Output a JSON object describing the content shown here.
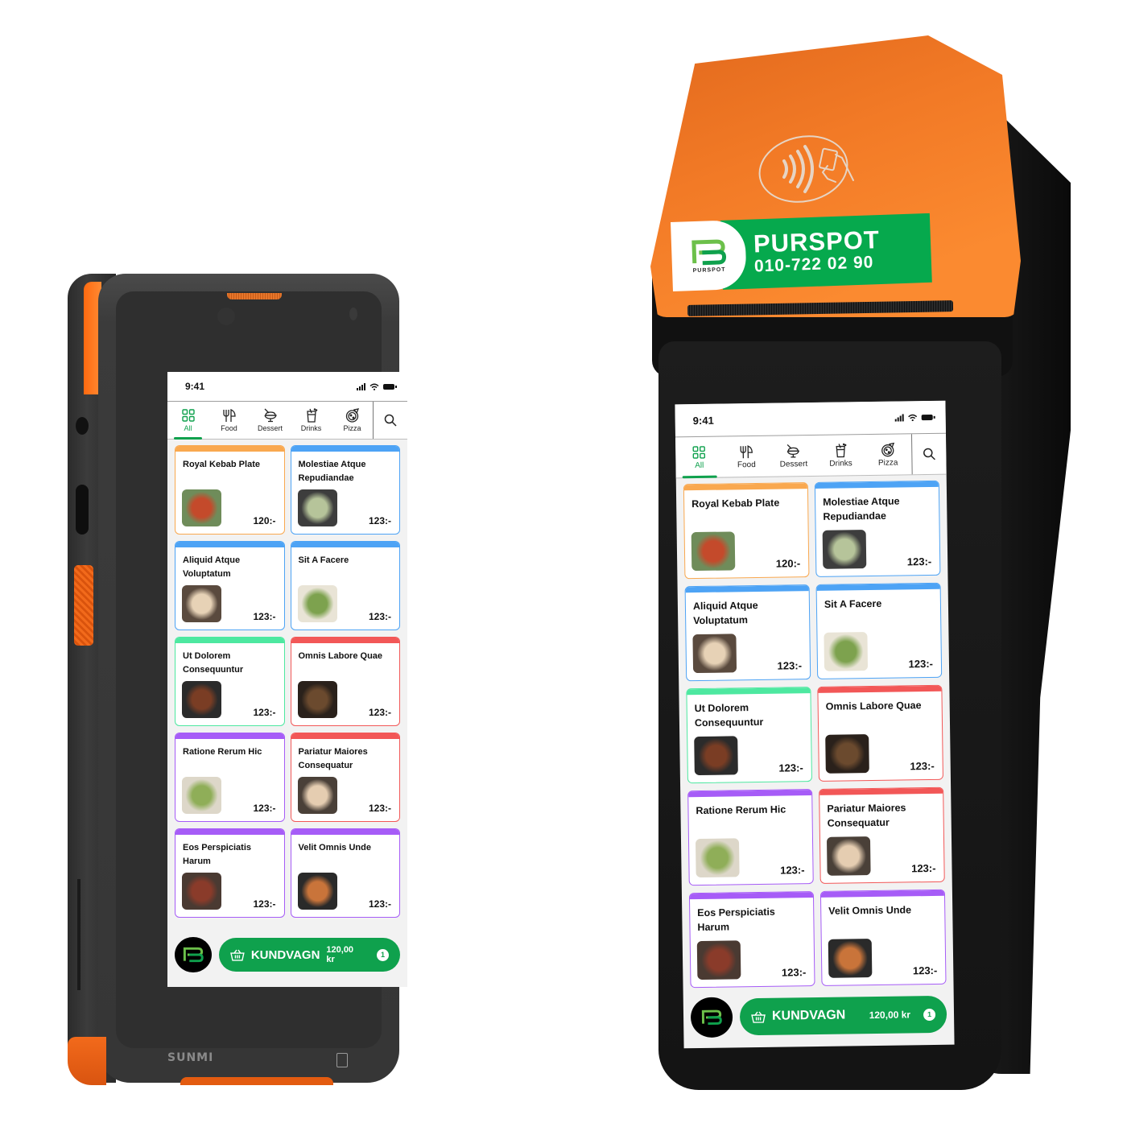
{
  "device_left": {
    "brand": "SUNMI"
  },
  "device_right": {
    "printer_label": {
      "title": "PURSPOT",
      "phone": "010-722 02 90",
      "logo_caption": "PURSPOT"
    }
  },
  "app": {
    "status_bar": {
      "time": "9:41"
    },
    "tabs": [
      {
        "label": "All",
        "icon": "grid-icon",
        "active": true
      },
      {
        "label": "Food",
        "icon": "fork-knife-icon",
        "active": false
      },
      {
        "label": "Dessert",
        "icon": "ice-cream-icon",
        "active": false
      },
      {
        "label": "Drinks",
        "icon": "drink-icon",
        "active": false
      },
      {
        "label": "Pizza",
        "icon": "pizza-icon",
        "active": false
      }
    ],
    "search_icon": "search-icon",
    "products": [
      {
        "name": "Royal Kebab Plate",
        "price": "120:-",
        "color": "#f9a84f",
        "thumb": [
          "#6f8c5a",
          "#c44a2b"
        ]
      },
      {
        "name": "Molestiae Atque Repudiandae",
        "price": "123:-",
        "color": "#4da3f5",
        "thumb": [
          "#3d3d3d",
          "#b6c49a"
        ]
      },
      {
        "name": "Aliquid Atque Voluptatum",
        "price": "123:-",
        "color": "#4da3f5",
        "thumb": [
          "#5a4a3e",
          "#e7d2b6"
        ]
      },
      {
        "name": "Sit A Facere",
        "price": "123:-",
        "color": "#4da3f5",
        "thumb": [
          "#e9e4d6",
          "#7da24e"
        ]
      },
      {
        "name": "Ut Dolorem Consequuntur",
        "price": "123:-",
        "color": "#4de8a0",
        "thumb": [
          "#2b2b2b",
          "#7a3d24"
        ]
      },
      {
        "name": "Omnis Labore Quae",
        "price": "123:-",
        "color": "#f25757",
        "thumb": [
          "#2a211b",
          "#6b4a2e"
        ]
      },
      {
        "name": "Ratione Rerum Hic",
        "price": "123:-",
        "color": "#a65cf7",
        "thumb": [
          "#ddd7c9",
          "#8fae58"
        ]
      },
      {
        "name": "Pariatur Maiores Consequatur",
        "price": "123:-",
        "color": "#f25757",
        "thumb": [
          "#4a4038",
          "#e5cdb1"
        ]
      },
      {
        "name": "Eos Perspiciatis Harum",
        "price": "123:-",
        "color": "#a65cf7",
        "thumb": [
          "#4a3a32",
          "#8a3b2a"
        ]
      },
      {
        "name": "Velit Omnis Unde",
        "price": "123:-",
        "color": "#a65cf7",
        "thumb": [
          "#2a2a2a",
          "#c9743a"
        ]
      }
    ],
    "cart": {
      "label": "KUNDVAGN",
      "total": "120,00 kr",
      "count": "1",
      "icon": "basket-icon"
    },
    "colors": {
      "accent": "#0fa14d",
      "logo_green": "#6cc04a"
    }
  }
}
